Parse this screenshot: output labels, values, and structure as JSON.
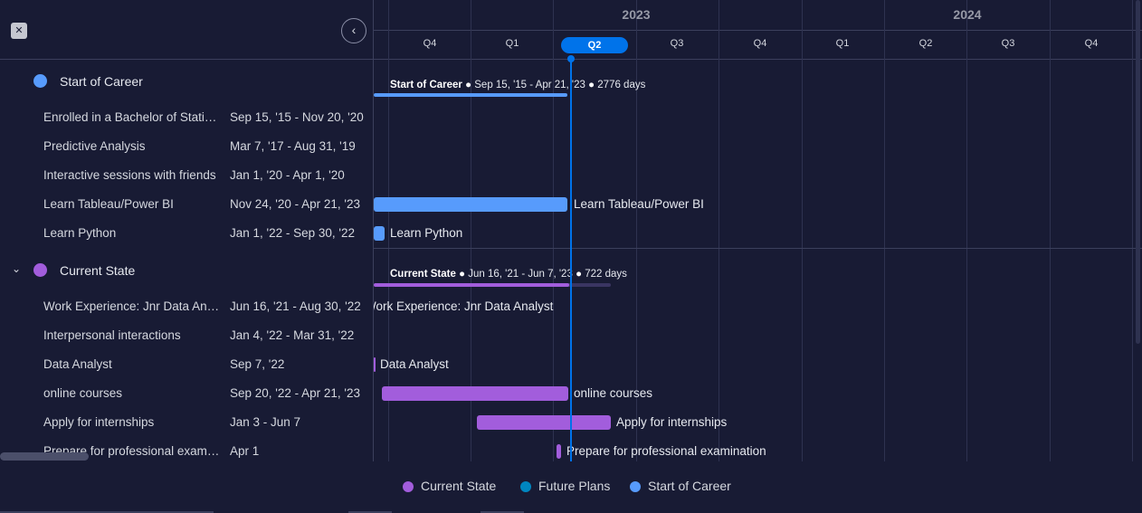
{
  "header": {
    "close_icon": "collapse-icon",
    "collapse_icon": "chevron-left-icon",
    "years": [
      "2023",
      "2024"
    ],
    "quarters": [
      "Q4",
      "Q1",
      "Q2",
      "Q3",
      "Q4",
      "Q1",
      "Q2",
      "Q3",
      "Q4"
    ],
    "active_quarter": "Q2"
  },
  "groups": [
    {
      "title": "Start of Career",
      "color": "#579bfc",
      "summary": {
        "name": "Start of Career",
        "dates": "Sep 15, '15 - Apr 21, '23",
        "days": "2776 days"
      },
      "items": [
        {
          "name": "Enrolled in a Bachelor of Statistics",
          "dates": "Sep 15, '15 - Nov 20, '20"
        },
        {
          "name": "Predictive Analysis",
          "dates": "Mar 7, '17 - Aug 31, '19"
        },
        {
          "name": "Interactive sessions with friends",
          "dates": "Jan 1, '20 - Apr 1, '20"
        },
        {
          "name": "Learn Tableau/Power BI",
          "dates": "Nov 24, '20 - Apr 21, '23",
          "bar_label": "Learn Tableau/Power BI"
        },
        {
          "name": "Learn Python",
          "dates": "Jan 1, '22 - Sep 30, '22",
          "bar_label": "Learn Python"
        }
      ]
    },
    {
      "title": "Current State",
      "color": "#a25ddc",
      "summary": {
        "name": "Current State",
        "dates": "Jun 16, '21 - Jun 7, '23",
        "days": "722 days"
      },
      "items": [
        {
          "name": "Work Experience: Jnr Data Analyst",
          "dates": "Jun 16, '21 - Aug 30, '22",
          "bar_label": "Work Experience: Jnr Data Analyst"
        },
        {
          "name": "Interpersonal interactions",
          "dates": "Jan 4, '22 - Mar 31, '22"
        },
        {
          "name": "Data Analyst",
          "dates": "Sep 7, '22",
          "bar_label": "Data Analyst"
        },
        {
          "name": "online courses",
          "dates": "Sep 20, '22 - Apr 21, '23",
          "bar_label": "online courses"
        },
        {
          "name": "Apply for internships",
          "dates": "Jan 3 - Jun 7",
          "bar_label": "Apply for internships"
        },
        {
          "name": "Prepare for professional examination",
          "dates": "Apr 1",
          "bar_label": "Prepare for professional examination"
        }
      ]
    }
  ],
  "legend": [
    {
      "label": "Current State",
      "color": "#a25ddc"
    },
    {
      "label": "Future Plans",
      "color": "#0086c0"
    },
    {
      "label": "Start of Career",
      "color": "#579bfc"
    }
  ]
}
